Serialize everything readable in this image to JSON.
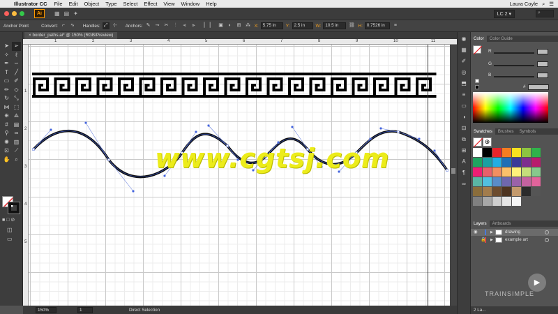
{
  "menubar": {
    "apple": "",
    "app_name": "Illustrator CC",
    "items": [
      "File",
      "Edit",
      "Object",
      "Type",
      "Select",
      "Effect",
      "View",
      "Window",
      "Help"
    ],
    "user": "Laura Coyle"
  },
  "appbar": {
    "logo": "Ai",
    "workspace": "LC 2 ▾"
  },
  "controlbar": {
    "tool_name": "Anchor Point",
    "convert_label": "Convert:",
    "handles_label": "Handles:",
    "anchors_label": "Anchors:",
    "x_label": "X:",
    "x_value": "5.75 in",
    "y_label": "Y:",
    "y_value": "2.5 in",
    "w_label": "W:",
    "w_value": "10.5 in",
    "h_label": "H:",
    "h_value": "0.7526 in"
  },
  "document": {
    "tab_title": "border_paths.ai* @ 150% (RGB/Preview)"
  },
  "rulers": {
    "top": [
      "1",
      "2",
      "3",
      "4",
      "5",
      "6",
      "7",
      "8",
      "9",
      "10",
      "11"
    ],
    "left": [
      "1",
      "2",
      "3",
      "4",
      "5"
    ]
  },
  "statusbar": {
    "zoom": "150%",
    "artboard": "1",
    "mode": "Direct Selection"
  },
  "color_panel": {
    "tabs": [
      "Color",
      "Color Guide"
    ],
    "channels": [
      "R",
      "G",
      "B"
    ],
    "hex_prefix": "#"
  },
  "swatches_panel": {
    "tabs": [
      "Swatches",
      "Brushes",
      "Symbols"
    ],
    "colors": [
      "#ffffff",
      "#000000",
      "#e8242a",
      "#f47d20",
      "#f9e11e",
      "#8dc540",
      "#2fb34a",
      "#1ea460",
      "#1ba0a3",
      "#23aee2",
      "#1f6fb6",
      "#3a3a98",
      "#7d2e8f",
      "#b81c6d",
      "#ed1d74",
      "#e8606b",
      "#f18f60",
      "#fbc06a",
      "#fff07a",
      "#c5de7b",
      "#86c98c",
      "#5ab6a4",
      "#52c0e0",
      "#5a8cc8",
      "#6f67ad",
      "#9a62a8",
      "#c462a0",
      "#e2639b",
      "#8a6d3b",
      "#a27c4c",
      "#6d4c2e",
      "#4e3420",
      "#c49a6c",
      "#2b2b2b",
      "#555555",
      "#808080",
      "#a8a8a8",
      "#cfcfcf",
      "#e5e5e5",
      "#f5f5f5"
    ]
  },
  "layers_panel": {
    "tabs": [
      "Layers",
      "Artboards"
    ],
    "layers": [
      {
        "name": "drawing",
        "color": "#4a7bd8"
      },
      {
        "name": "example art",
        "color": "#d8454a"
      }
    ],
    "footer": "2 La..."
  },
  "watermark": "www.cgtsj.com",
  "brand_overlay": "TRAINSIMPLE"
}
